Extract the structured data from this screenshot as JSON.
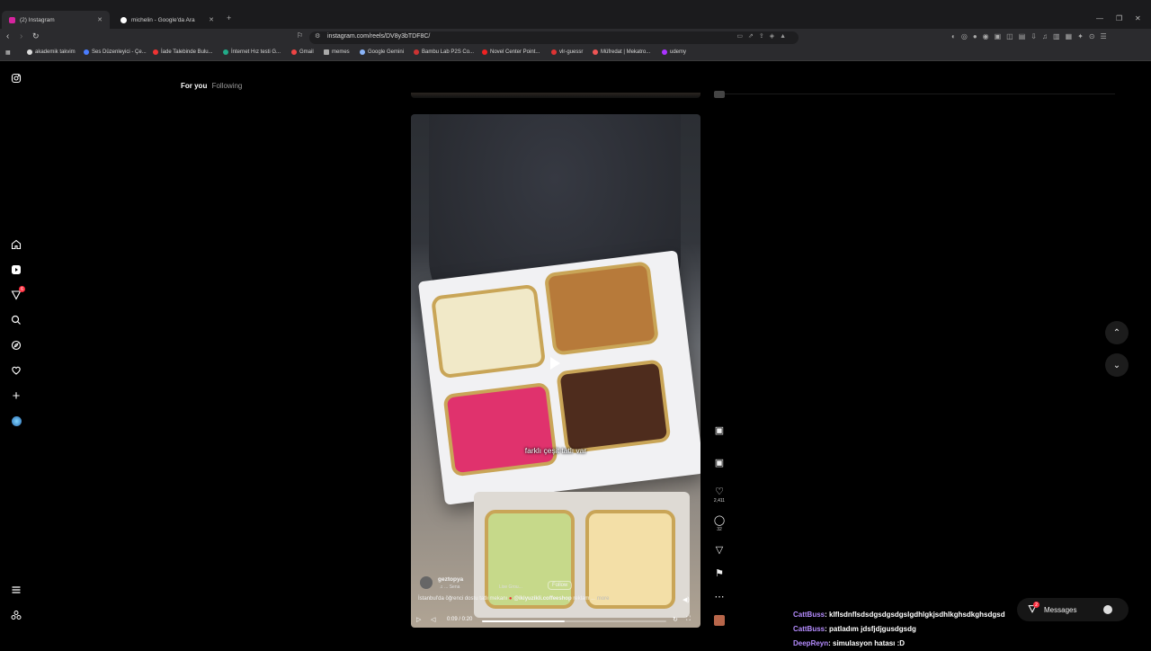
{
  "browser": {
    "tabs": [
      {
        "title": "(2) Instagram",
        "active": true
      },
      {
        "title": "michelin - Google'da Ara",
        "active": false
      }
    ],
    "url": "instagram.com/reels/DV8y3bTDF8C/",
    "bookmarks": [
      "akademik takvim",
      "Ses Düzenleyici - Çe...",
      "İade Talebinde Bulu...",
      "İnternet Hız testi G...",
      "Gmail",
      "memes",
      "Google Gemini",
      "Bambu Lab P2S Co...",
      "Novel Center Point...",
      "vlr-guessr",
      "Müfredat | Mekatro...",
      "udemy"
    ]
  },
  "feed_tabs": {
    "for_you": "For you",
    "following": "Following"
  },
  "notifications_badge": "6",
  "reel": {
    "caption": "farklı çeşit tatlı var",
    "username": "geztopya",
    "audio": "... Sena",
    "audio_2": "Lise Grou...",
    "follow_label": "Follow",
    "description_prefix": "İstanbul'da öğrenci dostu tatlı mekanı",
    "mention": "@ikiyuzikli.coffeeshop",
    "description_suffix": "reklam ...",
    "more": "more",
    "time": "0:09 / 0:20",
    "progress": 0.45,
    "likes": "2,411",
    "comments": "32"
  },
  "chat": [
    {
      "name": "CattBuss",
      "message": ": klflsdnflsdsdgsdgsdgslgdhlgkjsdhlkghsdkghsdgsd",
      "color": "#b58cff"
    },
    {
      "name": "CattBuss",
      "message": ": patladım jdsfjdjgusdgsdg",
      "color": "#b58cff"
    },
    {
      "name": "DeepReyn",
      "message": ": simulasyon hatası :D",
      "color": "#b58cff"
    }
  ],
  "messages": {
    "label": "Messages",
    "badge": "2"
  }
}
